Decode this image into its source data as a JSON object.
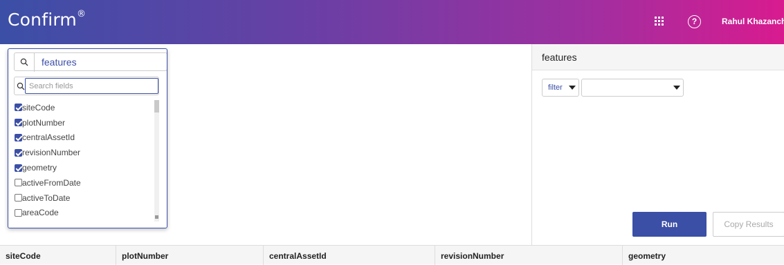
{
  "header": {
    "brand": "Confirm",
    "brand_mark": "®",
    "apps_icon": "apps-grid-icon",
    "help_icon": "help-icon",
    "help_glyph": "?",
    "user_name": "Rahul Khazanch",
    "gradient_colors": [
      "#3b4fa6",
      "#6a3fa5",
      "#a02fa0",
      "#d81b8f"
    ]
  },
  "picker": {
    "selected_value": "features",
    "search_placeholder": "Search fields",
    "fields": [
      {
        "label": "siteCode",
        "checked": true
      },
      {
        "label": "plotNumber",
        "checked": true
      },
      {
        "label": "centralAssetId",
        "checked": true
      },
      {
        "label": "revisionNumber",
        "checked": true
      },
      {
        "label": "geometry",
        "checked": true
      },
      {
        "label": "activeFromDate",
        "checked": false
      },
      {
        "label": "activeToDate",
        "checked": false
      },
      {
        "label": "areaCode",
        "checked": false
      }
    ]
  },
  "query_panel": {
    "title": "features",
    "filter_label": "filter",
    "filter_value": "",
    "run_label": "Run",
    "copy_label": "Copy Results"
  },
  "results": {
    "columns": [
      "siteCode",
      "plotNumber",
      "centralAssetId",
      "revisionNumber",
      "geometry"
    ]
  },
  "colors": {
    "accent": "#3b4fa6"
  }
}
